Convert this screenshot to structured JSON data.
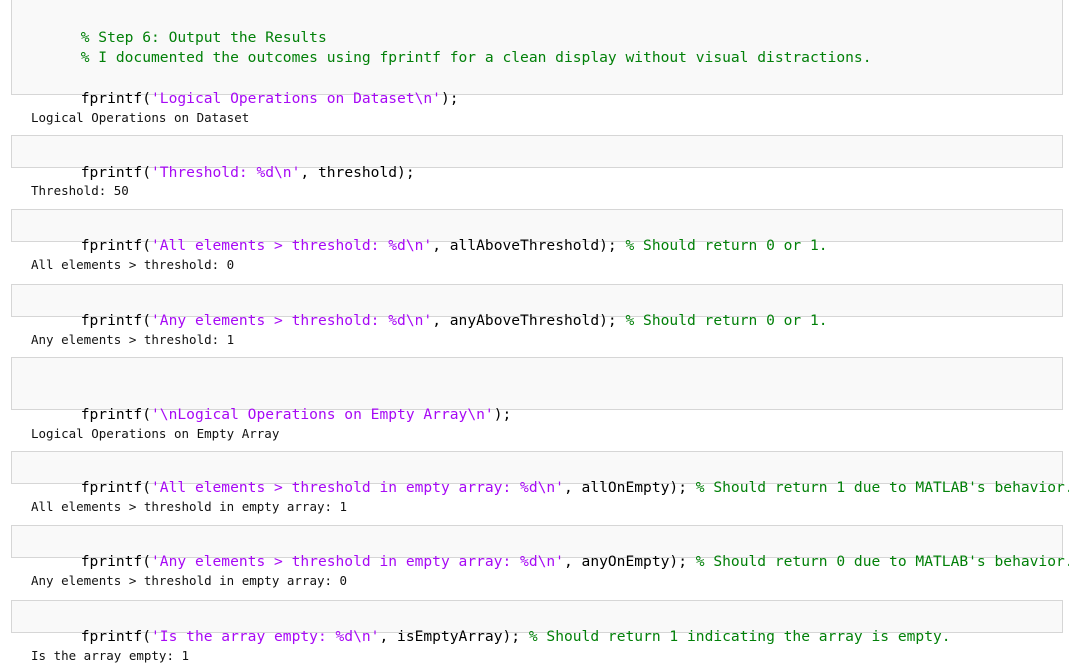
{
  "colors": {
    "comment": "#028009",
    "string": "#a709f5",
    "code": "#000000",
    "cell_background": "#f9f9f9",
    "cell_border": "#d6d6d6"
  },
  "cells": [
    {
      "code_lines": [
        {
          "comment": "% Step 6: Output the Results"
        },
        {
          "comment": "% I documented the outcomes using fprintf for a clean display without visual distractions."
        },
        {
          "call": "fprintf(",
          "string": "'Logical Operations on Dataset\\n'",
          "rest": ");",
          "comment": ""
        }
      ],
      "output": "Logical Operations on Dataset"
    },
    {
      "code_lines": [
        {
          "call": "fprintf(",
          "string": "'Threshold: %d\\n'",
          "rest": ", threshold);",
          "comment": ""
        }
      ],
      "output": "Threshold: 50"
    },
    {
      "code_lines": [
        {
          "call": "fprintf(",
          "string": "'All elements > threshold: %d\\n'",
          "rest": ", allAboveThreshold); ",
          "comment": "% Should return 0 or 1."
        }
      ],
      "output": "All elements > threshold: 0"
    },
    {
      "code_lines": [
        {
          "call": "fprintf(",
          "string": "'Any elements > threshold: %d\\n'",
          "rest": ", anyAboveThreshold); ",
          "comment": "% Should return 0 or 1."
        }
      ],
      "output": "Any elements > threshold: 1"
    },
    {
      "code_lines": [
        {
          "call": "fprintf(",
          "string": "'\\nLogical Operations on Empty Array\\n'",
          "rest": ");",
          "comment": ""
        }
      ],
      "output": "Logical Operations on Empty Array"
    },
    {
      "code_lines": [
        {
          "call": "fprintf(",
          "string": "'All elements > threshold in empty array: %d\\n'",
          "rest": ", allOnEmpty); ",
          "comment": "% Should return 1 due to MATLAB's behavior."
        }
      ],
      "output": "All elements > threshold in empty array: 1"
    },
    {
      "code_lines": [
        {
          "call": "fprintf(",
          "string": "'Any elements > threshold in empty array: %d\\n'",
          "rest": ", anyOnEmpty); ",
          "comment": "% Should return 0 due to MATLAB's behavior."
        }
      ],
      "output": "Any elements > threshold in empty array: 0"
    },
    {
      "code_lines": [
        {
          "call": "fprintf(",
          "string": "'Is the array empty: %d\\n'",
          "rest": ", isEmptyArray); ",
          "comment": "% Should return 1 indicating the array is empty."
        }
      ],
      "output": "Is the array empty: 1"
    }
  ]
}
